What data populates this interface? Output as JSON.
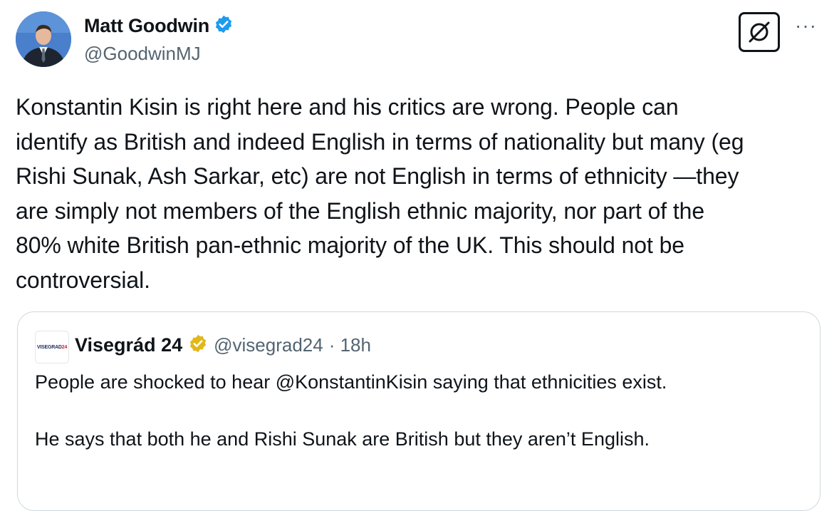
{
  "author": {
    "name": "Matt Goodwin",
    "handle": "@GoodwinMJ",
    "verified_badge": "blue-verified-icon",
    "avatar": "profile-photo"
  },
  "actions": {
    "grok_icon": "grok-icon",
    "more_icon": "more-options-icon",
    "more_glyph": "···"
  },
  "tweet": {
    "text": "Konstantin Kisin is right here and his critics are wrong. People can\nidentify as British and indeed English in terms of nationality but many (eg\nRishi Sunak, Ash Sarkar, etc) are not English in terms of ethnicity —they\nare simply not members of the English ethnic majority, nor part of the\n80% white British pan-ethnic majority of the UK. This should not be\ncontroversial."
  },
  "quoted": {
    "logo_text": "VISEGRAD",
    "logo_number": "24",
    "name": "Visegrád 24",
    "badge": "gold-verified-icon",
    "handle": "@visegrad24",
    "time": "· 18h",
    "text": "People are shocked to hear @KonstantinKisin saying that ethnicities exist.\n\nHe says that both he and Rishi Sunak are British but they aren’t English."
  },
  "colors": {
    "text": "#0f1419",
    "secondary": "#536471",
    "verified_blue": "#1d9bf0",
    "verified_gold": "#e2b719",
    "border": "#cfd9de"
  }
}
